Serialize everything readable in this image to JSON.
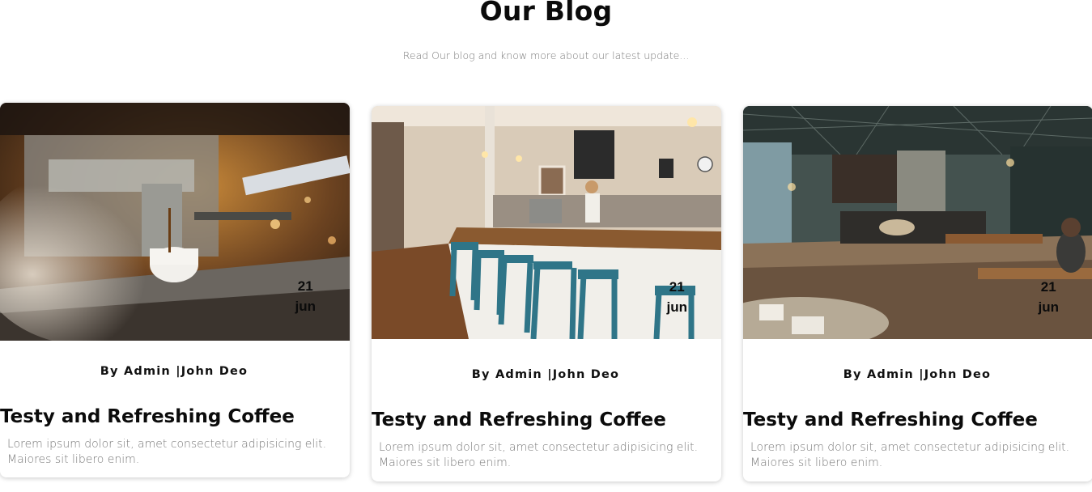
{
  "section": {
    "title": "Our Blog",
    "subtitle": "Read Our blog and know more about our latest update..."
  },
  "posts": [
    {
      "image_subject": "espresso-machine-photo",
      "date_day": "21",
      "date_month": "jun",
      "byline": "By Admin |John Deo",
      "title": "Testy and Refreshing Coffee",
      "excerpt": "Lorem ipsum dolor sit, amet consectetur adipisicing elit. Maiores sit libero enim."
    },
    {
      "image_subject": "coffee-bar-counter-photo",
      "date_day": "21",
      "date_month": "jun",
      "byline": "By Admin |John Deo",
      "title": "Testy and Refreshing Coffee",
      "excerpt": "Lorem ipsum dolor sit, amet consectetur adipisicing elit. Maiores sit libero enim."
    },
    {
      "image_subject": "cafe-interior-photo",
      "date_day": "21",
      "date_month": "jun",
      "byline": "By Admin |John Deo",
      "title": "Testy and Refreshing Coffee",
      "excerpt": "Lorem ipsum dolor sit, amet consectetur adipisicing elit. Maiores sit libero enim."
    }
  ]
}
